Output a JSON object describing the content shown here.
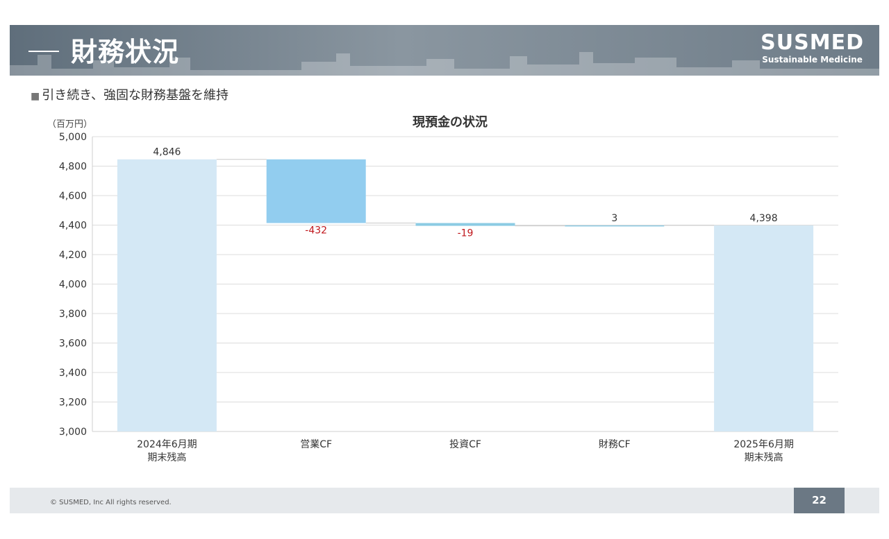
{
  "header": {
    "title": "財務状況",
    "logo_main": "SUSMED",
    "logo_sub": "Sustainable Medicine"
  },
  "subtitle": {
    "bullet": "■",
    "text": "引き続き、強固な財務基盤を維持"
  },
  "footer": {
    "copyright": "© SUSMED, Inc All rights reserved.",
    "page_number": "22"
  },
  "colors": {
    "total_bar": "#d4e8f5",
    "operating_bar": "#92cdef",
    "small_bar": "#8ccbe3",
    "negative_label": "#c0171c",
    "header_bg": "#6e7c88"
  },
  "chart_data": {
    "type": "bar",
    "subtype": "waterfall",
    "title": "現預金の状況",
    "unit_label": "（百万円）",
    "ylim": [
      3000,
      5000
    ],
    "yticks": [
      "3,000",
      "3,200",
      "3,400",
      "3,600",
      "3,800",
      "4,000",
      "4,200",
      "4,400",
      "4,600",
      "4,800",
      "5,000"
    ],
    "ytick_values": [
      3000,
      3200,
      3400,
      3600,
      3800,
      4000,
      4200,
      4400,
      4600,
      4800,
      5000
    ],
    "grid": true,
    "categories": [
      [
        "2024年6月期",
        "期末残高"
      ],
      [
        "営業CF"
      ],
      [
        "投資CF"
      ],
      [
        "財務CF"
      ],
      [
        "2025年6月期",
        "期末残高"
      ]
    ],
    "values": [
      4846,
      -432,
      -19,
      3,
      4398
    ],
    "labels": [
      "4,846",
      "-432",
      "-19",
      "3",
      "4,398"
    ],
    "kinds": [
      "total",
      "delta",
      "delta",
      "delta",
      "total"
    ]
  }
}
